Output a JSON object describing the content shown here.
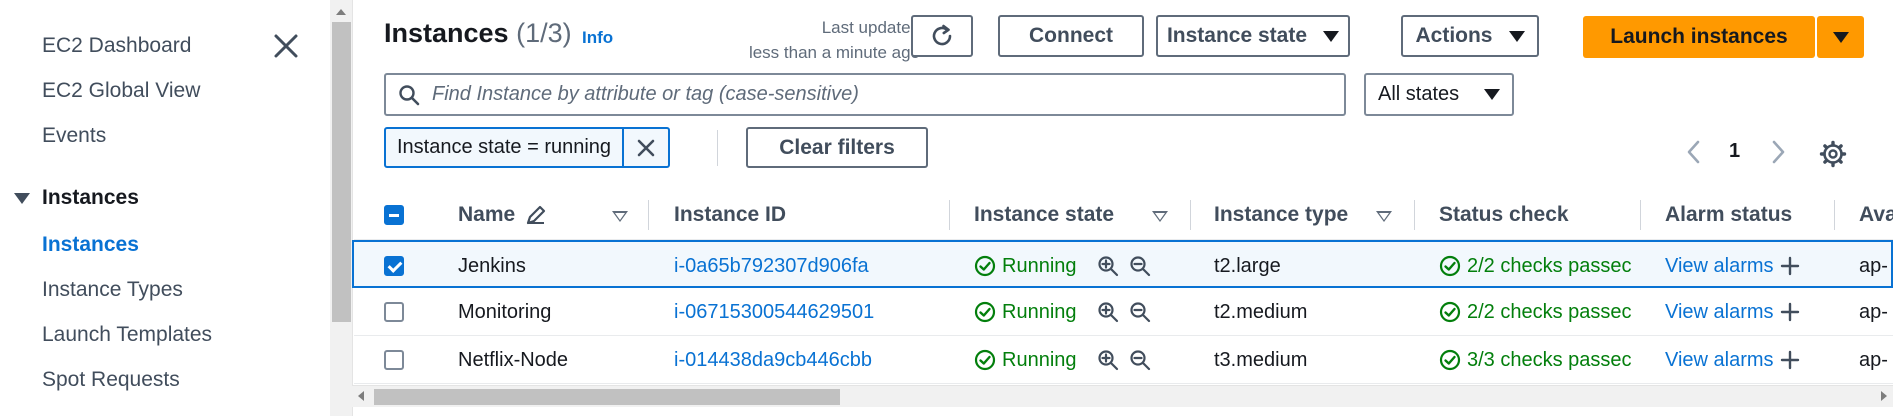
{
  "sidebar": {
    "close_icon": "close-icon",
    "items_top": [
      "EC2 Dashboard",
      "EC2 Global View",
      "Events"
    ],
    "section": "Instances",
    "items_sub": [
      "Instances",
      "Instance Types",
      "Launch Templates",
      "Spot Requests"
    ],
    "active": "Instances"
  },
  "header": {
    "title": "Instances",
    "count": "(1/3)",
    "info": "Info",
    "updated_line1": "Last updated",
    "updated_line2": "less than a minute ago",
    "connect": "Connect",
    "instance_state": "Instance state",
    "actions": "Actions",
    "launch": "Launch instances"
  },
  "filters": {
    "search_placeholder": "Find Instance by attribute or tag (case-sensitive)",
    "states_select": "All states",
    "token": "Instance state = running",
    "clear": "Clear filters",
    "page": "1"
  },
  "table": {
    "columns": [
      "Name",
      "Instance ID",
      "Instance state",
      "Instance type",
      "Status check",
      "Alarm status",
      "Ava"
    ],
    "rows": [
      {
        "selected": true,
        "name": "Jenkins",
        "id": "i-0a65b792307d906fa",
        "state": "Running",
        "type": "t2.large",
        "status": "2/2 checks passec",
        "alarm": "View alarms",
        "az": "ap-"
      },
      {
        "selected": false,
        "name": "Monitoring",
        "id": "i-06715300544629501",
        "state": "Running",
        "type": "t2.medium",
        "status": "2/2 checks passec",
        "alarm": "View alarms",
        "az": "ap-"
      },
      {
        "selected": false,
        "name": "Netflix-Node",
        "id": "i-014438da9cb446cbb",
        "state": "Running",
        "type": "t3.medium",
        "status": "3/3 checks passec",
        "alarm": "View alarms",
        "az": "ap-"
      }
    ]
  },
  "colors": {
    "link": "#0972d3",
    "primary": "#ff9900",
    "success": "#037f0c"
  }
}
